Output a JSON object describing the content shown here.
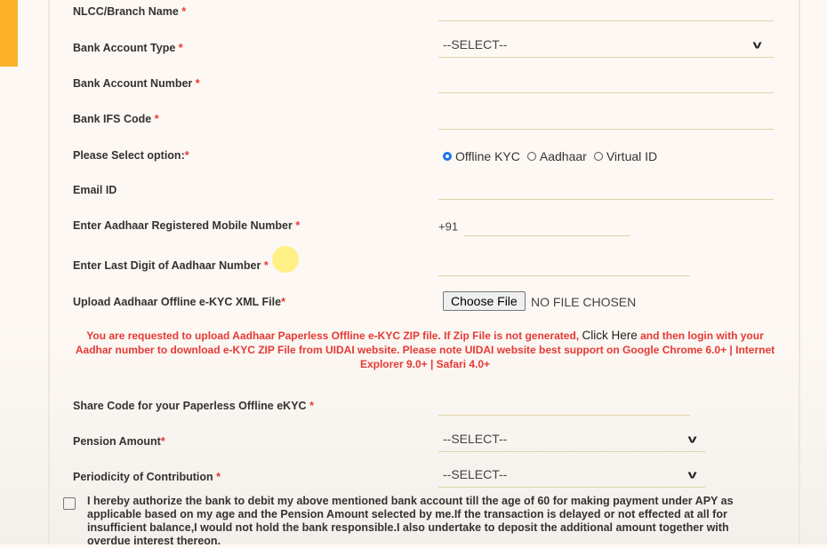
{
  "fields": [
    {
      "label": "NLCC/Branch Name",
      "req": "*"
    },
    {
      "label": "Bank Account Type",
      "req": "*",
      "value": "--SELECT--"
    },
    {
      "label": "Bank Account Number",
      "req": "*"
    },
    {
      "label": "Bank IFS Code",
      "req": "*"
    },
    {
      "label": "Please Select option:",
      "req": "*"
    },
    {
      "label": "Email ID",
      "req": ""
    },
    {
      "label": "Enter Aadhaar Registered Mobile Number",
      "req": "*",
      "prefix": "+91"
    },
    {
      "label": "Enter Last Digit of Aadhaar Number",
      "req": "*"
    },
    {
      "label": "Upload Aadhaar Offline e-KYC XML File",
      "req": "*"
    },
    {
      "label": "Share Code for your Paperless Offline eKYC",
      "req": "*"
    },
    {
      "label": "Pension Amount",
      "req": "*",
      "value": "--SELECT--"
    },
    {
      "label": "Periodicity of Contribution",
      "req": "*",
      "value": "--SELECT--"
    }
  ],
  "radio_options": [
    {
      "label": "Offline KYC",
      "checked": true
    },
    {
      "label": "Aadhaar",
      "checked": false
    },
    {
      "label": "Virtual ID",
      "checked": false
    }
  ],
  "file": {
    "button": "Choose File",
    "status": "NO FILE CHOSEN"
  },
  "notice": {
    "part1": "You are requested to upload Aadhaar Paperless Offline e-KYC ZIP file. If Zip File is not generated, ",
    "link": "Click Here",
    "part2": " and then login with your Aadhar number to download e-KYC ZIP File from UIDAI website. Please note UIDAI website best support on Google Chrome 6.0+ | Internet Explorer 9.0+ | Safari 4.0+"
  },
  "consent": "I hereby authorize the bank to debit my above mentioned bank account till the age of 60 for making payment under APY as applicable based on my age and the Pension Amount selected by me.If the transaction is delayed or not effected at all for insufficient balance,I would not hold the bank responsible.I also undertake to deposit the additional amount together with overdue interest thereon.",
  "colors": {
    "accent": "#fbb12a",
    "required": "#e53935",
    "radio": "#1a73e8"
  }
}
